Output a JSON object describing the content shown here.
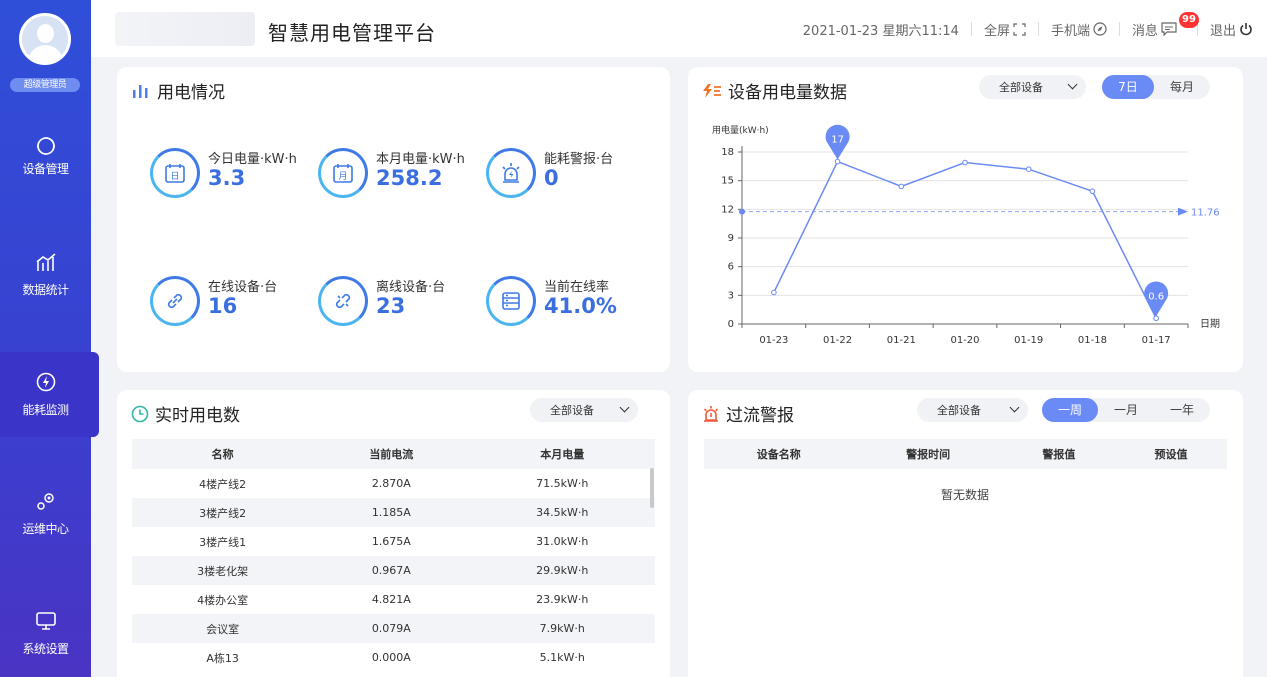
{
  "sidebar": {
    "role": "超级管理员",
    "items": [
      {
        "label": "设备管理",
        "icon": "refresh-icon"
      },
      {
        "label": "数据统计",
        "icon": "chart-icon"
      },
      {
        "label": "能耗监测",
        "icon": "energy-icon"
      },
      {
        "label": "运维中心",
        "icon": "gears-icon"
      },
      {
        "label": "系统设置",
        "icon": "monitor-icon"
      }
    ],
    "active_index": 2
  },
  "header": {
    "title": "智慧用电管理平台",
    "datetime": "2021-01-23 星期六11:14",
    "fullscreen": "全屏",
    "mobile": "手机端",
    "messages": "消息",
    "message_count": "99",
    "logout": "退出"
  },
  "usage": {
    "title": "用电情况",
    "stats": [
      {
        "label": "今日电量·kW·h",
        "value": "3.3",
        "icon": "calendar-day-icon"
      },
      {
        "label": "本月电量·kW·h",
        "value": "258.2",
        "icon": "calendar-month-icon"
      },
      {
        "label": "能耗警报·台",
        "value": "0",
        "icon": "alarm-light-icon"
      },
      {
        "label": "在线设备·台",
        "value": "16",
        "icon": "link-icon"
      },
      {
        "label": "离线设备·台",
        "value": "23",
        "icon": "broken-link-icon"
      },
      {
        "label": "当前在线率",
        "value": "41.0%",
        "icon": "server-icon"
      }
    ]
  },
  "device_usage": {
    "title": "设备用电量数据",
    "select": "全部设备",
    "tabs": [
      "7日",
      "每月"
    ],
    "active_tab": 0
  },
  "chart_data": {
    "type": "line",
    "ylabel": "用电量(kW·h)",
    "xlabel": "日期",
    "categories": [
      "01-23",
      "01-22",
      "01-21",
      "01-20",
      "01-19",
      "01-18",
      "01-17"
    ],
    "values": [
      3.3,
      17,
      14.4,
      16.9,
      16.2,
      13.9,
      0.6
    ],
    "ylim": [
      0,
      18
    ],
    "yticks": [
      0,
      3,
      6,
      9,
      12,
      15,
      18
    ],
    "average": 11.76,
    "max_label": "17",
    "min_label": "0.6",
    "color": "#6a8af5",
    "grid": true
  },
  "realtime": {
    "title": "实时用电数",
    "select": "全部设备",
    "columns": [
      "名称",
      "当前电流",
      "本月电量"
    ],
    "rows": [
      [
        "4楼产线2",
        "2.870A",
        "71.5kW·h"
      ],
      [
        "3楼产线2",
        "1.185A",
        "34.5kW·h"
      ],
      [
        "3楼产线1",
        "1.675A",
        "31.0kW·h"
      ],
      [
        "3楼老化架",
        "0.967A",
        "29.9kW·h"
      ],
      [
        "4楼办公室",
        "4.821A",
        "23.9kW·h"
      ],
      [
        "会议室",
        "0.079A",
        "7.9kW·h"
      ],
      [
        "A栋13",
        "0.000A",
        "5.1kW·h"
      ]
    ]
  },
  "overcurrent": {
    "title": "过流警报",
    "select": "全部设备",
    "tabs": [
      "一周",
      "一月",
      "一年"
    ],
    "active_tab": 0,
    "columns": [
      "设备名称",
      "警报时间",
      "警报值",
      "预设值"
    ],
    "empty": "暂无数据"
  },
  "colors": {
    "accent": "#6a8af5",
    "sidebar": "#3a3fcf",
    "alarm": "#f05a3a"
  }
}
